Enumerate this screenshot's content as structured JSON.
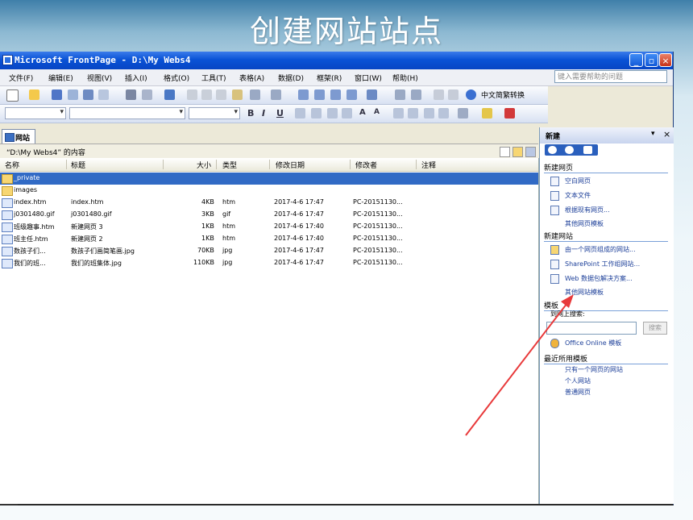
{
  "slide": {
    "title": "创建网站站点"
  },
  "window": {
    "title": "Microsoft FrontPage - D:\\My Webs4"
  },
  "menu": {
    "items": [
      "文件(F)",
      "编辑(E)",
      "视图(V)",
      "插入(I)",
      "格式(O)",
      "工具(T)",
      "表格(A)",
      "数据(D)",
      "框架(R)",
      "窗口(W)",
      "帮助(H)"
    ],
    "help_placeholder": "键入需要帮助的问题"
  },
  "toolbar": {
    "convert_label": "中文简繁转换"
  },
  "view_tab": {
    "label": "网站"
  },
  "folder": {
    "path_label": "“D:\\My Webs4” 的内容"
  },
  "columns": [
    "名称",
    "标题",
    "大小",
    "类型",
    "修改日期",
    "修改者",
    "注释"
  ],
  "files": [
    {
      "name": "_private",
      "title": "",
      "size": "",
      "type": "",
      "date": "",
      "modified_by": "",
      "icon": "folder-icon"
    },
    {
      "name": "images",
      "title": "",
      "size": "",
      "type": "",
      "date": "",
      "modified_by": "",
      "icon": "folder-icon"
    },
    {
      "name": "index.htm",
      "title": "index.htm",
      "size": "4KB",
      "type": "htm",
      "date": "2017-4-6 17:47",
      "modified_by": "PC-20151130...",
      "icon": "home-page-icon"
    },
    {
      "name": "j0301480.gif",
      "title": "j0301480.gif",
      "size": "3KB",
      "type": "gif",
      "date": "2017-4-6 17:47",
      "modified_by": "PC-20151130...",
      "icon": "image-file-icon"
    },
    {
      "name": "班级趣事.htm",
      "title": "新建网页 3",
      "size": "1KB",
      "type": "htm",
      "date": "2017-4-6 17:40",
      "modified_by": "PC-20151130...",
      "icon": "web-page-icon"
    },
    {
      "name": "班主任.htm",
      "title": "新建网页 2",
      "size": "1KB",
      "type": "htm",
      "date": "2017-4-6 17:40",
      "modified_by": "PC-20151130...",
      "icon": "web-page-icon"
    },
    {
      "name": "数孩子们...",
      "title": "数孩子们画简笔画.jpg",
      "size": "70KB",
      "type": "jpg",
      "date": "2017-4-6 17:47",
      "modified_by": "PC-20151130...",
      "icon": "image-file-icon"
    },
    {
      "name": "我们的班...",
      "title": "我们的班集体.jpg",
      "size": "110KB",
      "type": "jpg",
      "date": "2017-4-6 17:47",
      "modified_by": "PC-20151130...",
      "icon": "image-file-icon"
    }
  ],
  "taskpane": {
    "title": "新建",
    "sections": {
      "new_page": "新建网页",
      "new_site": "新建网站",
      "templates": "模板",
      "search_label": "到网上搜索:",
      "search_button": "搜索",
      "recent": "最近所用模板"
    },
    "new_page_links": [
      "空白网页",
      "文本文件",
      "根据现有网页...",
      "其他网页模板"
    ],
    "new_site_links": [
      "由一个网页组成的网站...",
      "SharePoint 工作组网站...",
      "Web 数据包解决方案...",
      "其他网站模板"
    ],
    "online_templates": "Office Online 模板",
    "recent_links": [
      "只有一个网页的网站",
      "个人网站",
      "普通网页"
    ]
  },
  "colors": {
    "title_bar": "#0a53d6",
    "selection": "#316ac5",
    "annotation_arrow": "#e8393a",
    "link": "#1c3f99"
  }
}
